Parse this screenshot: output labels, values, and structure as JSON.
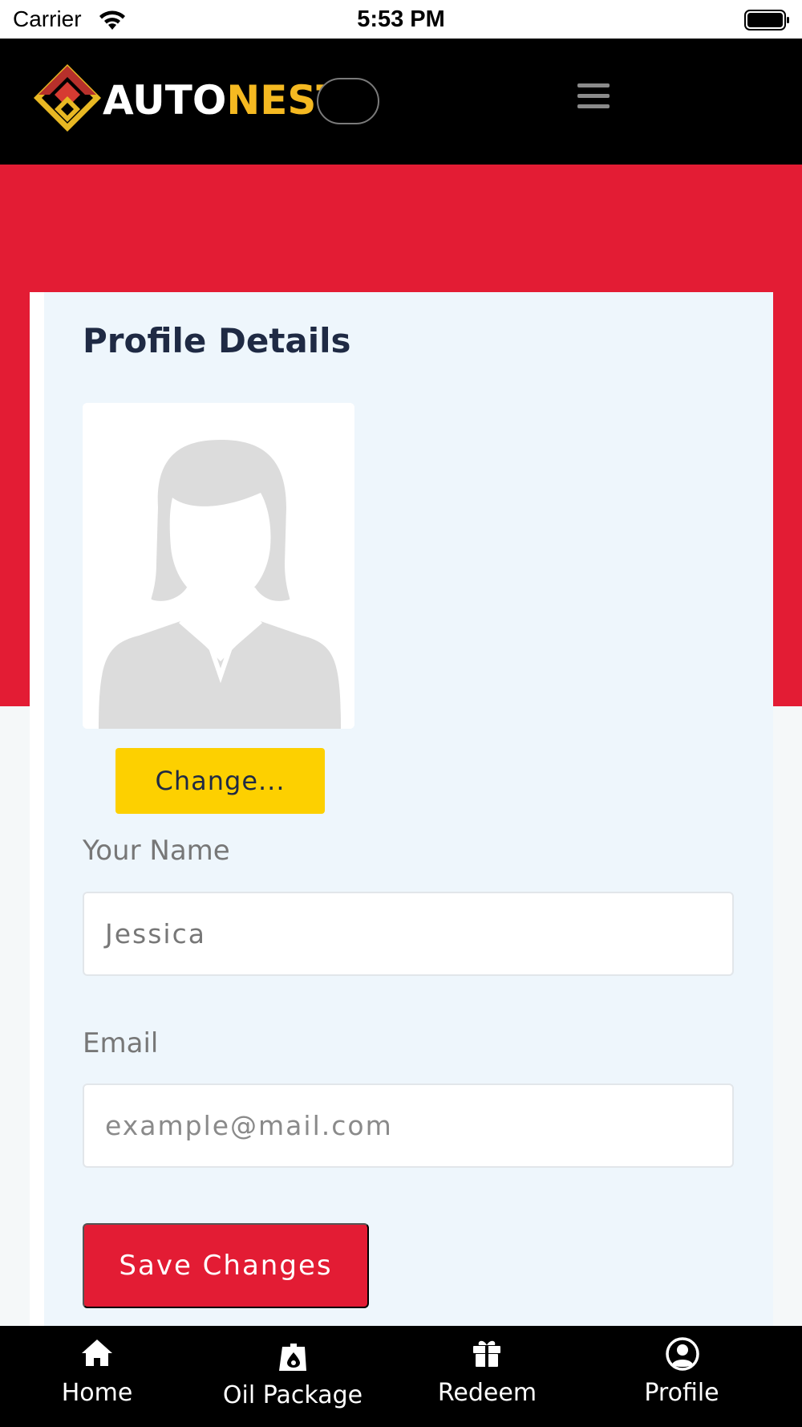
{
  "status_bar": {
    "carrier": "Carrier",
    "time": "5:53 PM"
  },
  "header": {
    "brand_part1": "AUTO",
    "brand_part2": "NEST",
    "menu_icon": "hamburger-icon",
    "colors": {
      "brand_accent": "#f5b921",
      "background": "#000000"
    }
  },
  "profile": {
    "title": "Profile Details",
    "avatar_icon": "avatar-placeholder-icon",
    "change_label": "Change...",
    "name_label": "Your Name",
    "name_value": "Jessica",
    "email_label": "Email",
    "email_placeholder": "example@mail.com",
    "save_label": "Save Changes",
    "colors": {
      "primary": "#e31c34",
      "change_button": "#fdd000"
    }
  },
  "bottom_nav": {
    "items": [
      {
        "label": "Home",
        "icon": "home-icon"
      },
      {
        "label": "Oil Package",
        "icon": "oil-package-icon"
      },
      {
        "label": "Redeem",
        "icon": "gift-icon"
      },
      {
        "label": "Profile",
        "icon": "profile-icon"
      }
    ]
  }
}
